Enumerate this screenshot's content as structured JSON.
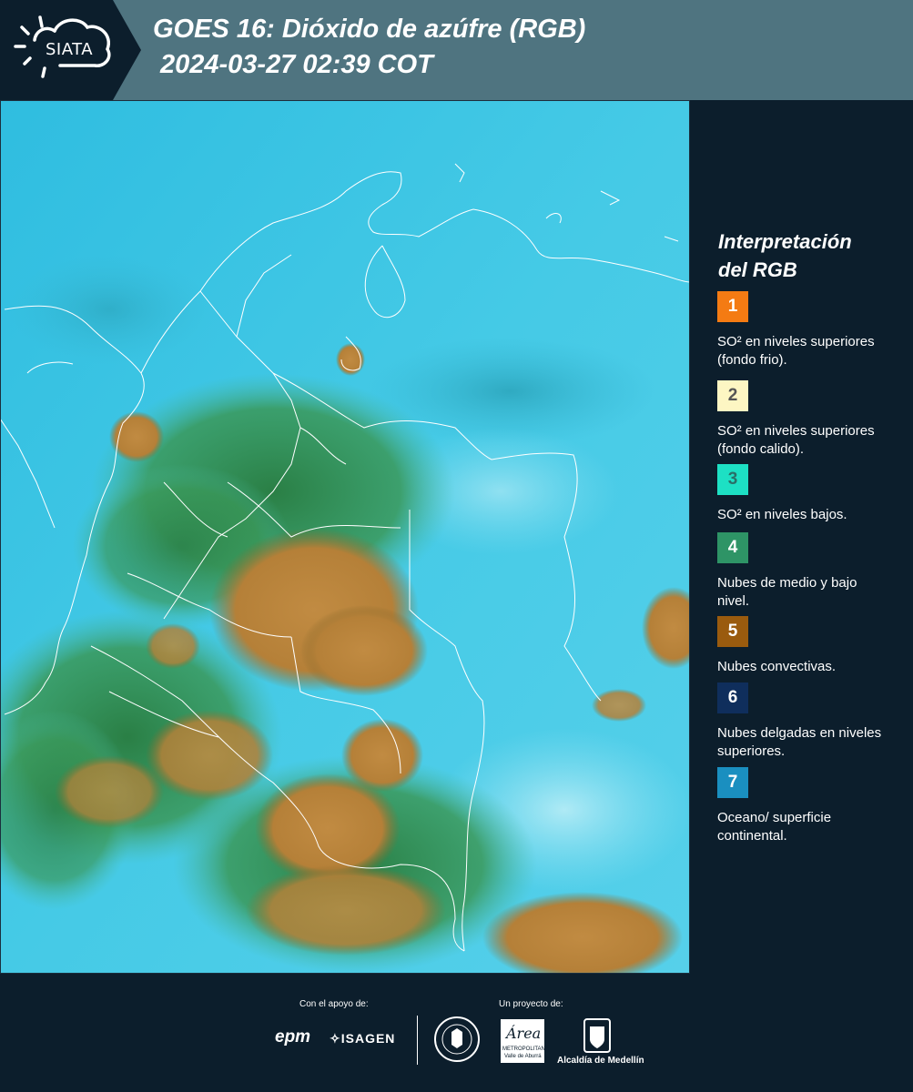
{
  "header": {
    "logo_text": "SIATA",
    "title_line1": "GOES 16: Dióxido de azúfre (RGB)",
    "title_line2": "2024-03-27 02:39 COT"
  },
  "legend": {
    "title_line1": "Interpretación",
    "title_line2": "del RGB",
    "items": [
      {
        "number": "1",
        "color": "#f47b13",
        "num_color": "#ffffff",
        "text_html": "SO² en niveles superiores (fondo frio)."
      },
      {
        "number": "2",
        "color": "#fdf6c3",
        "num_color": "#555555",
        "text_html": "SO² en niveles superiores (fondo calido)."
      },
      {
        "number": "3",
        "color": "#1de0c4",
        "num_color": "#2a6f68",
        "text_html": "SO² en niveles bajos."
      },
      {
        "number": "4",
        "color": "#2e9466",
        "num_color": "#ffffff",
        "text_html": "Nubes de medio y bajo nivel."
      },
      {
        "number": "5",
        "color": "#9a5b0e",
        "num_color": "#ffffff",
        "text_html": "Nubes convectivas."
      },
      {
        "number": "6",
        "color": "#0f2e5c",
        "num_color": "#ffffff",
        "text_html": "Nubes delgadas en niveles superiores."
      },
      {
        "number": "7",
        "color": "#1a8fc0",
        "num_color": "#ffffff",
        "text_html": "Oceano/ superficie continental."
      }
    ]
  },
  "footer": {
    "support_label": "Con el apoyo de:",
    "project_label": "Un proyecto de:",
    "epm": "epm",
    "isagen": "ISAGEN",
    "area_name": "Área",
    "area_sub1": "METROPOLITANA",
    "area_sub2": "Valle de Aburrá",
    "alcaldia": "Alcaldía de Medellín"
  },
  "colors": {
    "header_bg": "#4f7480",
    "logo_bg": "#0c1e2c",
    "panel_bg": "#0c1e2c",
    "sky_cyan": "#3ac8e4",
    "convective_brown": "#b9843a",
    "vegetation_green": "#2f8a4c"
  },
  "map": {
    "labels": []
  }
}
